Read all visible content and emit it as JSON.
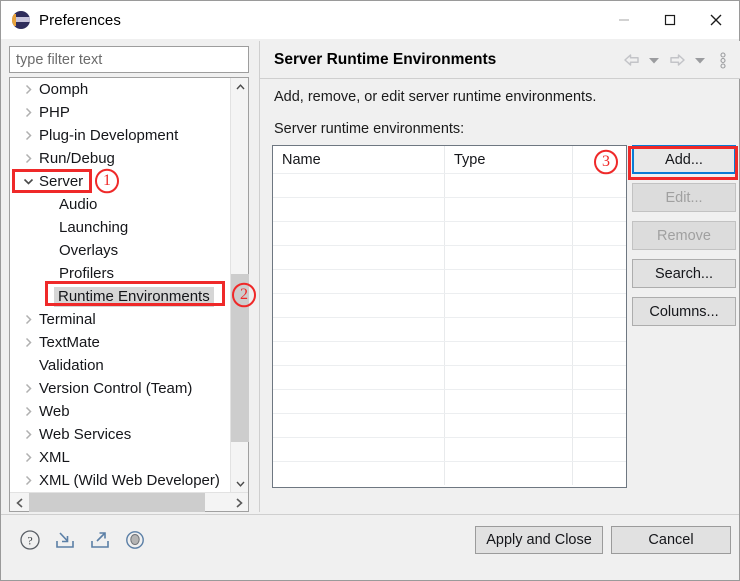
{
  "window": {
    "title": "Preferences",
    "icon": "eclipse-logo-icon",
    "controls": {
      "minimize": "minimize-icon",
      "maximize": "maximize-icon",
      "close": "close-icon"
    }
  },
  "filter": {
    "placeholder": "type filter text",
    "value": ""
  },
  "tree": {
    "items": [
      {
        "label": "Oomph",
        "level": 1,
        "expander": "collapsed",
        "selected": false
      },
      {
        "label": "PHP",
        "level": 1,
        "expander": "collapsed",
        "selected": false
      },
      {
        "label": "Plug-in Development",
        "level": 1,
        "expander": "collapsed",
        "selected": false
      },
      {
        "label": "Run/Debug",
        "level": 1,
        "expander": "collapsed",
        "selected": false
      },
      {
        "label": "Server",
        "level": 1,
        "expander": "expanded",
        "selected": false
      },
      {
        "label": "Audio",
        "level": 2,
        "expander": "none",
        "selected": false
      },
      {
        "label": "Launching",
        "level": 2,
        "expander": "none",
        "selected": false
      },
      {
        "label": "Overlays",
        "level": 2,
        "expander": "none",
        "selected": false
      },
      {
        "label": "Profilers",
        "level": 2,
        "expander": "none",
        "selected": false
      },
      {
        "label": "Runtime Environments",
        "level": 2,
        "expander": "none",
        "selected": true
      },
      {
        "label": "Terminal",
        "level": 1,
        "expander": "collapsed",
        "selected": false
      },
      {
        "label": "TextMate",
        "level": 1,
        "expander": "collapsed",
        "selected": false
      },
      {
        "label": "Validation",
        "level": 1,
        "expander": "none",
        "selected": false
      },
      {
        "label": "Version Control (Team)",
        "level": 1,
        "expander": "collapsed",
        "selected": false
      },
      {
        "label": "Web",
        "level": 1,
        "expander": "collapsed",
        "selected": false
      },
      {
        "label": "Web Services",
        "level": 1,
        "expander": "collapsed",
        "selected": false
      },
      {
        "label": "XML",
        "level": 1,
        "expander": "collapsed",
        "selected": false
      },
      {
        "label": "XML (Wild Web Developer)",
        "level": 1,
        "expander": "collapsed",
        "selected": false
      }
    ]
  },
  "page": {
    "title": "Server Runtime Environments",
    "description": "Add, remove, or edit server runtime environments.",
    "list_label": "Server runtime environments:",
    "toolbar": [
      {
        "name": "back-arrow-icon",
        "label": "Back"
      },
      {
        "name": "chevron-down-icon",
        "label": "Back history"
      },
      {
        "name": "forward-arrow-icon",
        "label": "Forward"
      },
      {
        "name": "chevron-down-icon",
        "label": "Forward history"
      },
      {
        "name": "vertical-ellipsis-icon",
        "label": "View menu"
      }
    ]
  },
  "table": {
    "columns": [
      "Name",
      "Type",
      ""
    ],
    "rows": [],
    "empty_row_count": 13
  },
  "side_buttons": [
    {
      "label": "Add...",
      "enabled": true,
      "focused": true
    },
    {
      "label": "Edit...",
      "enabled": false,
      "focused": false
    },
    {
      "label": "Remove",
      "enabled": false,
      "focused": false
    },
    {
      "label": "Search...",
      "enabled": true,
      "focused": false
    },
    {
      "label": "Columns...",
      "enabled": true,
      "focused": false
    }
  ],
  "bottom": {
    "icons": [
      {
        "name": "help-icon",
        "label": "Help"
      },
      {
        "name": "import-icon",
        "label": "Import preferences"
      },
      {
        "name": "export-icon",
        "label": "Export preferences"
      },
      {
        "name": "record-icon",
        "label": "Record preferences"
      }
    ],
    "apply_label": "Apply and Close",
    "cancel_label": "Cancel"
  },
  "annotations": [
    {
      "number": "1",
      "target": "server-tree-item"
    },
    {
      "number": "2",
      "target": "runtime-environments-tree-item"
    },
    {
      "number": "3",
      "target": "add-button"
    }
  ],
  "colors": {
    "annotation_red": "#ef2929",
    "focus_blue": "#0a7bd4",
    "selection_gray": "#d6d6d6"
  }
}
